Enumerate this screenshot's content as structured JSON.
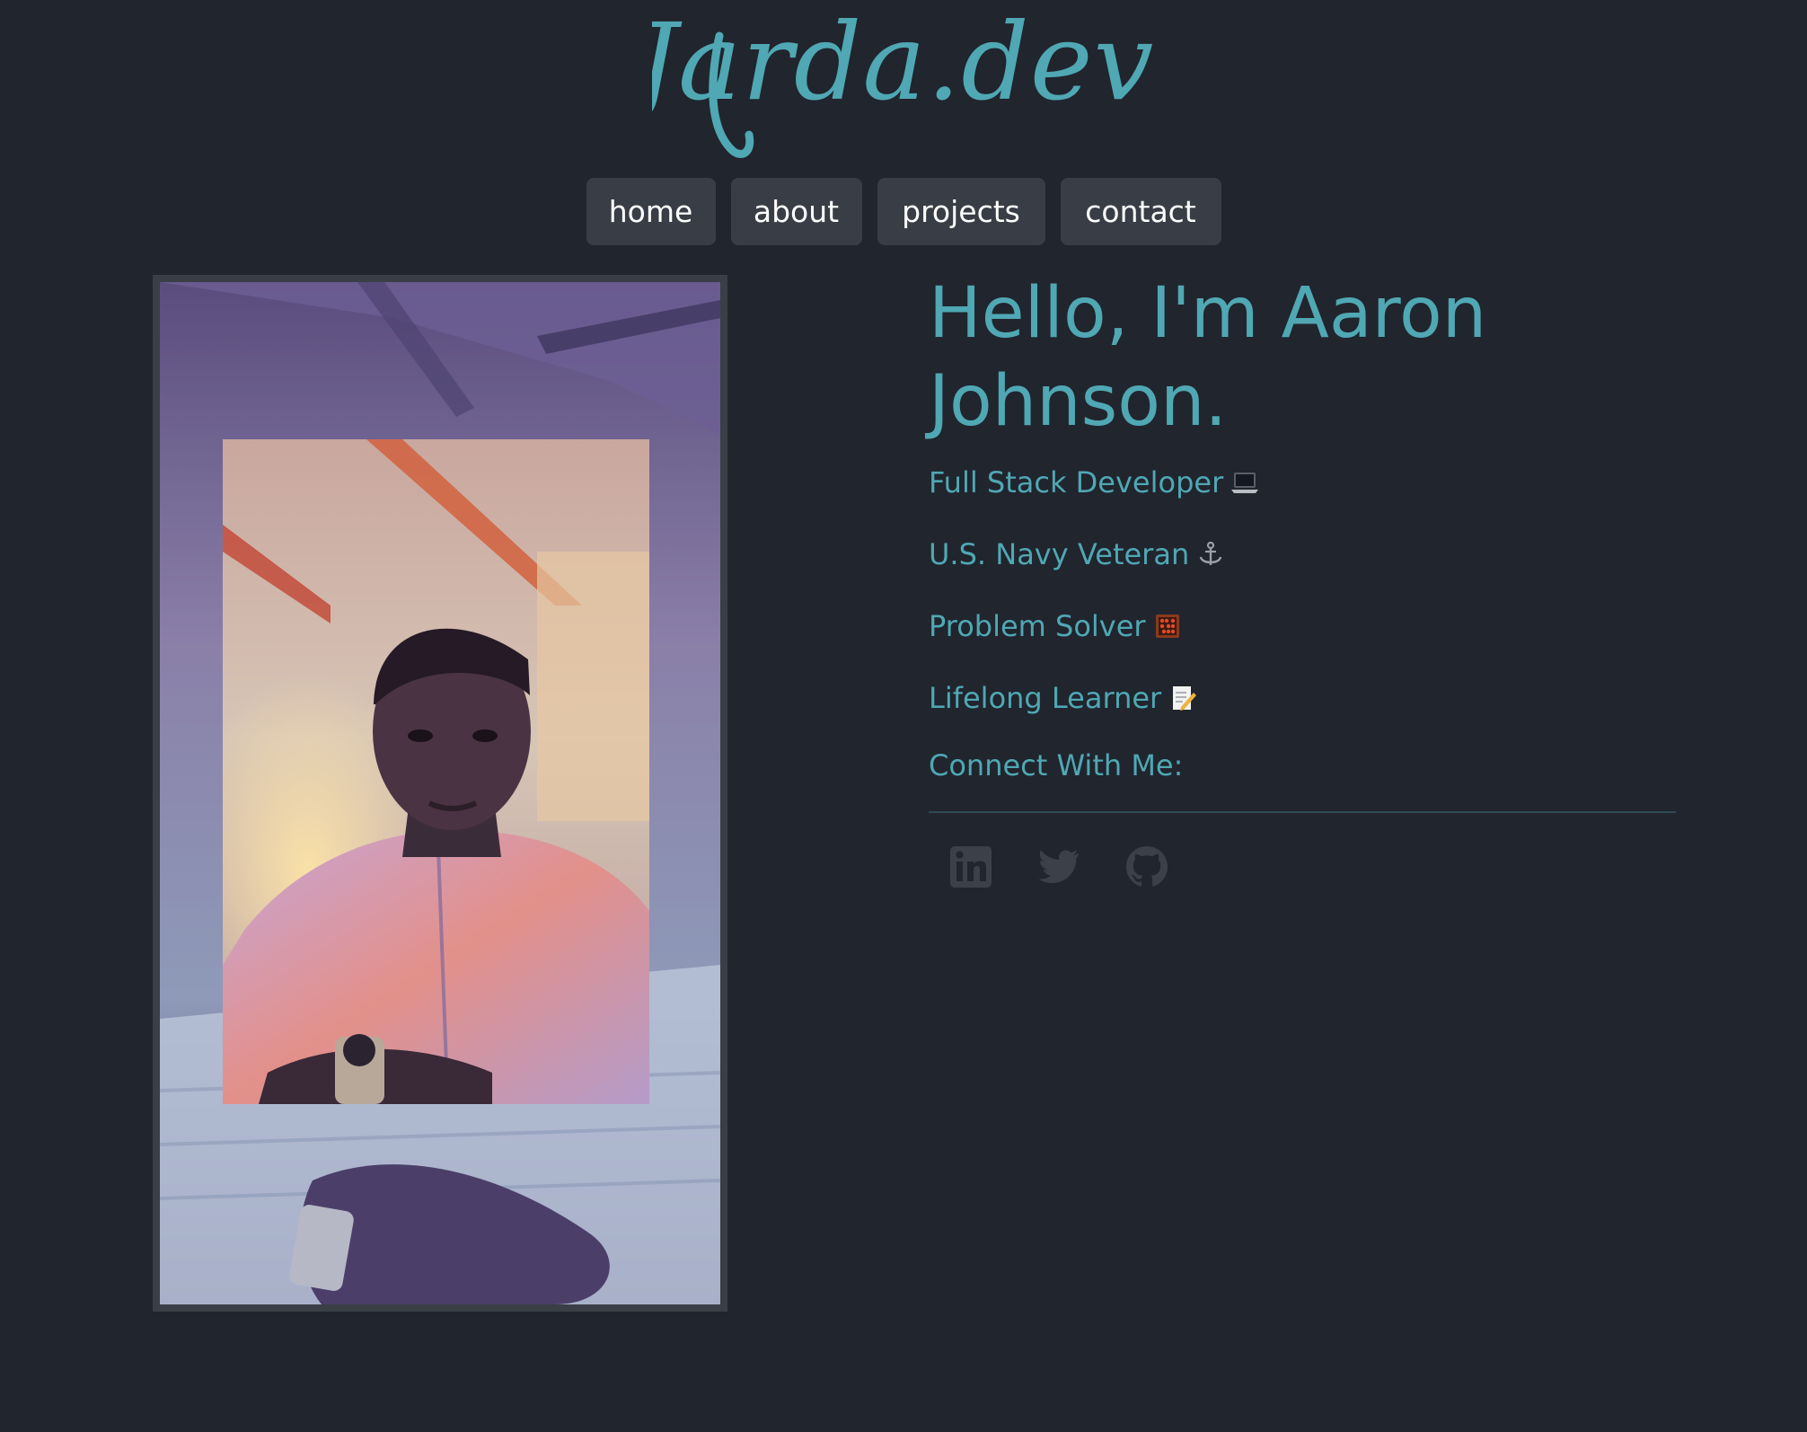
{
  "site": {
    "logo_text": "Jarda.dev"
  },
  "nav": {
    "items": [
      {
        "label": "home"
      },
      {
        "label": "about"
      },
      {
        "label": "projects"
      },
      {
        "label": "contact"
      }
    ]
  },
  "intro": {
    "greeting_line1": "Hello, I'm Aaron",
    "greeting_line2": "Johnson.",
    "taglines": [
      {
        "text": "Full Stack Developer",
        "icon": "laptop-icon"
      },
      {
        "text": "U.S. Navy Veteran",
        "icon": "anchor-icon"
      },
      {
        "text": "Problem Solver",
        "icon": "abacus-icon"
      },
      {
        "text": "Lifelong Learner",
        "icon": "memo-icon"
      }
    ],
    "connect_label": "Connect With Me:"
  },
  "socials": [
    {
      "name": "linkedin-icon"
    },
    {
      "name": "twitter-icon"
    },
    {
      "name": "github-icon"
    }
  ],
  "colors": {
    "background": "#21252e",
    "accent": "#4fa8b3",
    "nav_button": "#393d45",
    "social_icon": "#3b4049"
  }
}
